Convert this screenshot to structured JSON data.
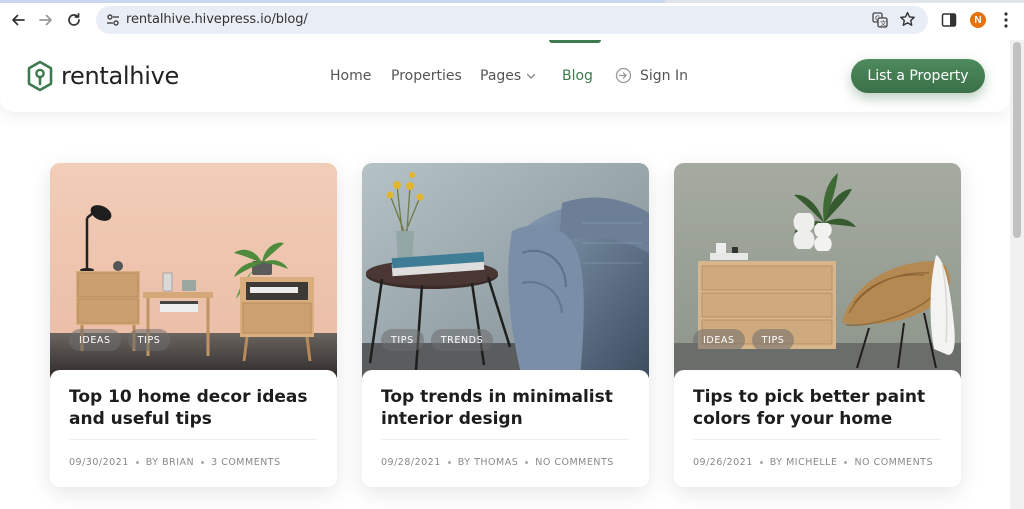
{
  "browser": {
    "url": "rentalhive.hivepress.io/blog/",
    "profile_initial": "N",
    "profile_color": "#e8710a",
    "icons": [
      "back-arrow-icon",
      "forward-arrow-icon",
      "reload-icon",
      "site-settings-icon",
      "translate-icon",
      "bookmark-star-icon",
      "side-panel-icon",
      "more-menu-icon"
    ]
  },
  "site": {
    "logo_text": "rentalhive",
    "brand_color": "#3d7a4f",
    "nav": {
      "home": "Home",
      "properties": "Properties",
      "pages": "Pages",
      "blog": "Blog",
      "sign_in": "Sign In",
      "active": "Blog"
    },
    "cta_label": "List a Property"
  },
  "posts": [
    {
      "title": "Top 10 home decor ideas and useful tips",
      "tags": [
        "IDEAS",
        "TIPS"
      ],
      "date": "09/30/2021",
      "author": "BY BRIAN",
      "comments": "3 COMMENTS",
      "image_icon": "bedroom-decor-photo"
    },
    {
      "title": "Top trends in minimalist interior design",
      "tags": [
        "TIPS",
        "TRENDS"
      ],
      "date": "09/28/2021",
      "author": "BY THOMAS",
      "comments": "NO COMMENTS",
      "image_icon": "armchair-side-table-photo"
    },
    {
      "title": "Tips to pick better paint colors for your home",
      "tags": [
        "IDEAS",
        "TIPS"
      ],
      "date": "09/26/2021",
      "author": "BY MICHELLE",
      "comments": "NO COMMENTS",
      "image_icon": "dresser-rattan-chair-photo"
    }
  ]
}
